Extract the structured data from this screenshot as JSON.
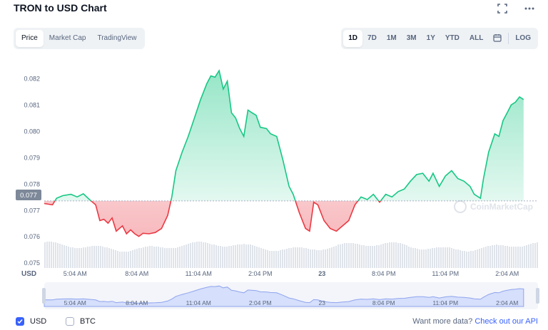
{
  "title": "TRON to USD Chart",
  "icons": {
    "fullscreen": "fullscreen-icon",
    "more": "more-horizontal-icon",
    "calendar": "calendar-icon",
    "check": "check-icon"
  },
  "view_tabs": [
    {
      "label": "Price",
      "active": true
    },
    {
      "label": "Market Cap",
      "active": false
    },
    {
      "label": "TradingView",
      "active": false
    }
  ],
  "range_tabs": [
    {
      "label": "1D",
      "active": true
    },
    {
      "label": "7D",
      "active": false
    },
    {
      "label": "1M",
      "active": false
    },
    {
      "label": "3M",
      "active": false
    },
    {
      "label": "1Y",
      "active": false
    },
    {
      "label": "YTD",
      "active": false
    },
    {
      "label": "ALL",
      "active": false
    }
  ],
  "log_label": "LOG",
  "colors": {
    "up": "#16c784",
    "down": "#ea3943",
    "volume": "#dfe3ea",
    "nav_fill": "#d6dffb",
    "nav_line": "#8fa4ee",
    "accent": "#3861fb"
  },
  "chart_data": {
    "type": "area",
    "currency_label": "USD",
    "y_ticks": [
      "0.082",
      "0.081",
      "0.080",
      "0.079",
      "0.078",
      "0.077",
      "0.076",
      "0.075"
    ],
    "ylim": [
      0.0748,
      0.0826
    ],
    "baseline": 0.07735,
    "baseline_label": "0.077",
    "x_labels": [
      "5:04 AM",
      "8:04 AM",
      "11:04 AM",
      "2:04 PM",
      "23",
      "8:04 PM",
      "11:04 PM",
      "2:04 AM"
    ],
    "hours_span": 24,
    "series": [
      {
        "values": [
          [
            0.0,
            0.07725
          ],
          [
            0.4,
            0.0772
          ],
          [
            0.6,
            0.07745
          ],
          [
            0.9,
            0.07755
          ],
          [
            1.3,
            0.0776
          ],
          [
            1.6,
            0.0775
          ],
          [
            1.9,
            0.07762
          ],
          [
            2.2,
            0.0774
          ],
          [
            2.5,
            0.0772
          ],
          [
            2.7,
            0.0766
          ],
          [
            2.9,
            0.07665
          ],
          [
            3.1,
            0.0765
          ],
          [
            3.3,
            0.0767
          ],
          [
            3.5,
            0.0762
          ],
          [
            3.8,
            0.0764
          ],
          [
            4.0,
            0.0761
          ],
          [
            4.2,
            0.07625
          ],
          [
            4.4,
            0.0761
          ],
          [
            4.6,
            0.076
          ],
          [
            4.8,
            0.07612
          ],
          [
            5.1,
            0.0761
          ],
          [
            5.4,
            0.07615
          ],
          [
            5.7,
            0.0763
          ],
          [
            6.0,
            0.0768
          ],
          [
            6.2,
            0.0775
          ],
          [
            6.4,
            0.0785
          ],
          [
            6.7,
            0.0792
          ],
          [
            7.0,
            0.0798
          ],
          [
            7.3,
            0.0805
          ],
          [
            7.6,
            0.0812
          ],
          [
            7.9,
            0.0818
          ],
          [
            8.1,
            0.0821
          ],
          [
            8.3,
            0.08205
          ],
          [
            8.5,
            0.0823
          ],
          [
            8.7,
            0.0816
          ],
          [
            8.9,
            0.0819
          ],
          [
            9.1,
            0.0807
          ],
          [
            9.3,
            0.0805
          ],
          [
            9.5,
            0.0801
          ],
          [
            9.7,
            0.0798
          ],
          [
            9.9,
            0.0808
          ],
          [
            10.1,
            0.0807
          ],
          [
            10.3,
            0.0806
          ],
          [
            10.5,
            0.08015
          ],
          [
            10.8,
            0.0801
          ],
          [
            11.0,
            0.0799
          ],
          [
            11.3,
            0.0798
          ],
          [
            11.6,
            0.0789
          ],
          [
            11.9,
            0.0779
          ],
          [
            12.1,
            0.0776
          ],
          [
            12.4,
            0.0769
          ],
          [
            12.7,
            0.0763
          ],
          [
            12.9,
            0.0762
          ],
          [
            13.1,
            0.0773
          ],
          [
            13.3,
            0.0772
          ],
          [
            13.6,
            0.0766
          ],
          [
            13.9,
            0.0763
          ],
          [
            14.2,
            0.0762
          ],
          [
            14.5,
            0.0764
          ],
          [
            14.8,
            0.0766
          ],
          [
            15.1,
            0.0772
          ],
          [
            15.4,
            0.0775
          ],
          [
            15.7,
            0.0774
          ],
          [
            16.0,
            0.0776
          ],
          [
            16.3,
            0.0773
          ],
          [
            16.6,
            0.0776
          ],
          [
            16.9,
            0.0775
          ],
          [
            17.2,
            0.0777
          ],
          [
            17.5,
            0.0778
          ],
          [
            17.8,
            0.0781
          ],
          [
            18.1,
            0.07835
          ],
          [
            18.4,
            0.0784
          ],
          [
            18.7,
            0.0781
          ],
          [
            18.9,
            0.0784
          ],
          [
            19.2,
            0.0779
          ],
          [
            19.5,
            0.0783
          ],
          [
            19.8,
            0.0785
          ],
          [
            20.1,
            0.0782
          ],
          [
            20.4,
            0.0781
          ],
          [
            20.7,
            0.0779
          ],
          [
            20.9,
            0.0776
          ],
          [
            21.2,
            0.07745
          ],
          [
            21.35,
            0.0782
          ],
          [
            21.6,
            0.0792
          ],
          [
            21.9,
            0.0799
          ],
          [
            22.1,
            0.0798
          ],
          [
            22.3,
            0.0804
          ],
          [
            22.5,
            0.0807
          ],
          [
            22.7,
            0.081
          ],
          [
            22.9,
            0.0811
          ],
          [
            23.1,
            0.0813
          ],
          [
            23.3,
            0.0812
          ]
        ]
      }
    ]
  },
  "watermark": "CoinMarketCap",
  "footer": {
    "checkboxes": [
      {
        "label": "USD",
        "checked": true
      },
      {
        "label": "BTC",
        "checked": false
      }
    ],
    "cta_text": "Want more data?",
    "cta_link": "Check out our API"
  }
}
